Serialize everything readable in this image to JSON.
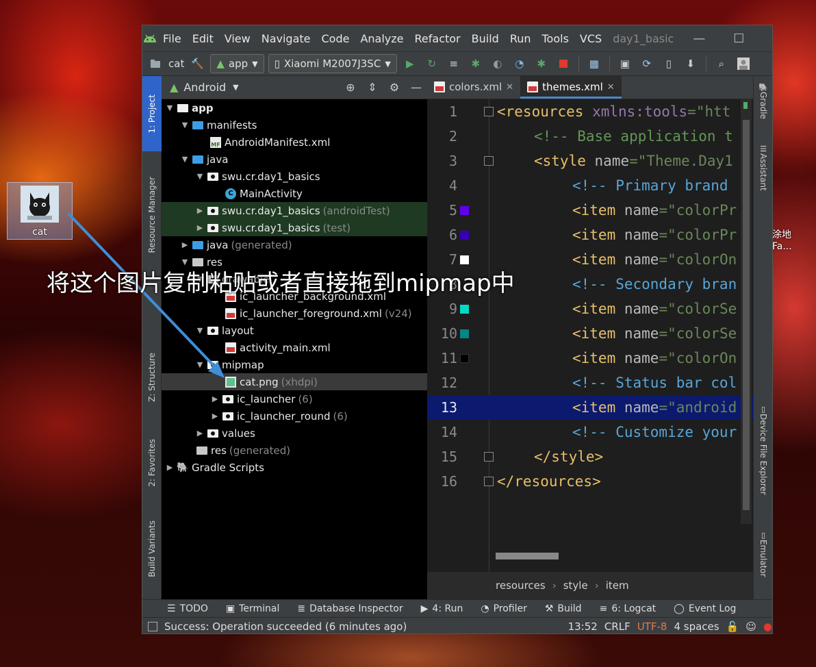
{
  "desktop": {
    "icon_label": "cat",
    "right_text_1": "涂地",
    "right_text_2": "Fa...",
    "caption": "将这个图片复制粘贴或者直接拖到mipmap中"
  },
  "menubar": {
    "items": [
      "File",
      "Edit",
      "View",
      "Navigate",
      "Code",
      "Analyze",
      "Refactor",
      "Build",
      "Run",
      "Tools",
      "VCS"
    ],
    "project_title": "day1_basic",
    "minimize": "—",
    "maximize": "☐",
    "close": "✕"
  },
  "toolbar": {
    "project": "cat",
    "module": "app",
    "device": "Xiaomi M2007J3SC"
  },
  "left_strip": {
    "project": "1: Project",
    "resource_manager": "Resource Manager",
    "structure": "Z: Structure",
    "favorites": "2: Favorites",
    "build_variants": "Build Variants"
  },
  "right_strip": {
    "gradle": "Gradle",
    "assistant": "Assistant",
    "device_file_explorer": "Device File Explorer",
    "emulator": "Emulator"
  },
  "project_panel": {
    "view": "Android",
    "tree": [
      {
        "name": "app",
        "extra": ""
      },
      {
        "name": "manifests",
        "extra": ""
      },
      {
        "name": "AndroidManifest.xml",
        "extra": ""
      },
      {
        "name": "java",
        "extra": ""
      },
      {
        "name": "swu.cr.day1_basics",
        "extra": ""
      },
      {
        "name": "MainActivity",
        "extra": ""
      },
      {
        "name": "swu.cr.day1_basics",
        "extra": "(androidTest)"
      },
      {
        "name": "swu.cr.day1_basics",
        "extra": "(test)"
      },
      {
        "name": "java",
        "extra": "(generated)"
      },
      {
        "name": "res",
        "extra": ""
      },
      {
        "name": "drawable",
        "extra": ""
      },
      {
        "name": "ic_launcher_background.xml",
        "extra": ""
      },
      {
        "name": "ic_launcher_foreground.xml",
        "extra": "(v24)"
      },
      {
        "name": "layout",
        "extra": ""
      },
      {
        "name": "activity_main.xml",
        "extra": ""
      },
      {
        "name": "mipmap",
        "extra": ""
      },
      {
        "name": "cat.png",
        "extra": "(xhdpi)"
      },
      {
        "name": "ic_launcher",
        "extra": "(6)"
      },
      {
        "name": "ic_launcher_round",
        "extra": "(6)"
      },
      {
        "name": "values",
        "extra": ""
      },
      {
        "name": "res",
        "extra": "(generated)"
      },
      {
        "name": "Gradle Scripts",
        "extra": ""
      }
    ]
  },
  "editor": {
    "tabs": [
      {
        "label": "colors.xml",
        "active": false
      },
      {
        "label": "themes.xml",
        "active": true
      }
    ],
    "lines": [
      {
        "n": "1",
        "swatch": null
      },
      {
        "n": "2",
        "swatch": null
      },
      {
        "n": "3",
        "swatch": null
      },
      {
        "n": "4",
        "swatch": null
      },
      {
        "n": "5",
        "swatch": "#6200ee"
      },
      {
        "n": "6",
        "swatch": "#3700b3"
      },
      {
        "n": "7",
        "swatch": "#ffffff"
      },
      {
        "n": "8",
        "swatch": null
      },
      {
        "n": "9",
        "swatch": "#03dac5"
      },
      {
        "n": "10",
        "swatch": "#018786"
      },
      {
        "n": "11",
        "swatch": "#000000"
      },
      {
        "n": "12",
        "swatch": null
      },
      {
        "n": "13",
        "swatch": null
      },
      {
        "n": "14",
        "swatch": null
      },
      {
        "n": "15",
        "swatch": null
      },
      {
        "n": "16",
        "swatch": null
      }
    ],
    "code": {
      "l1a": "<resources ",
      "l1b": "xmlns:",
      "l1c": "tools",
      "l1d": "=",
      "l1e": "\"htt",
      "l2": "<!-- Base application t",
      "l3a": "<style ",
      "l3b": "name",
      "l3c": "=",
      "l3d": "\"Theme.Day1",
      "l4": "<!-- Primary brand",
      "l5a": "<item ",
      "l5b": "name",
      "l5c": "=",
      "l5d": "\"colorPr",
      "l6a": "<item ",
      "l6b": "name",
      "l6c": "=",
      "l6d": "\"colorPr",
      "l7a": "<item ",
      "l7b": "name",
      "l7c": "=",
      "l7d": "\"colorOn",
      "l8": "<!-- Secondary bran",
      "l9a": "<item ",
      "l9b": "name",
      "l9c": "=",
      "l9d": "\"colorSe",
      "l10a": "<item ",
      "l10b": "name",
      "l10c": "=",
      "l10d": "\"colorSe",
      "l11a": "<item ",
      "l11b": "name",
      "l11c": "=",
      "l11d": "\"colorOn",
      "l12": "<!-- Status bar col",
      "l13a": "<item ",
      "l13b": "name",
      "l13c": "=",
      "l13d": "\"android",
      "l14": "<!-- Customize your",
      "l15": "</style>",
      "l16": "</resources>"
    },
    "breadcrumb": [
      "resources",
      "style",
      "item"
    ]
  },
  "bottom_tools": {
    "todo": "TODO",
    "terminal": "Terminal",
    "database": "Database Inspector",
    "run": "4: Run",
    "profiler": "Profiler",
    "build": "Build",
    "logcat": "6: Logcat",
    "event_log": "Event Log"
  },
  "status": {
    "message": "Success: Operation succeeded (6 minutes ago)",
    "position": "13:52",
    "line_sep": "CRLF",
    "encoding": "UTF-8",
    "indent": "4 spaces"
  },
  "colors": {
    "accent": "#2f65ca",
    "tab_underline": "#4a88c7",
    "caret_line": "#0b1a6e"
  }
}
